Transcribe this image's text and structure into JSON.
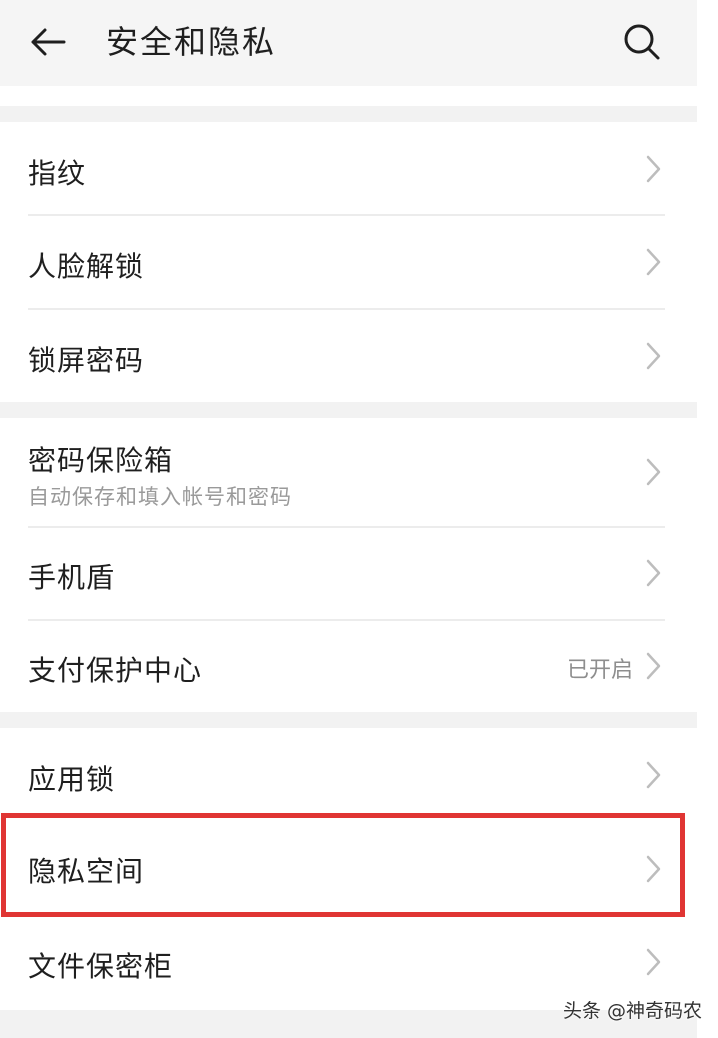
{
  "header": {
    "title": "安全和隐私",
    "back_icon": "arrow-left-icon",
    "search_icon": "search-icon"
  },
  "groups": [
    {
      "items": [
        {
          "label": "指纹"
        },
        {
          "label": "人脸解锁"
        },
        {
          "label": "锁屏密码"
        }
      ]
    },
    {
      "items": [
        {
          "label": "密码保险箱",
          "subtitle": "自动保存和填入帐号和密码"
        },
        {
          "label": "手机盾"
        },
        {
          "label": "支付保护中心",
          "value": "已开启"
        }
      ]
    },
    {
      "items": [
        {
          "label": "应用锁"
        },
        {
          "label": "隐私空间",
          "highlighted": true
        },
        {
          "label": "文件保密柜"
        }
      ]
    }
  ],
  "colors": {
    "highlight": "#e03533",
    "header_bg": "#f5f5f5",
    "group_gap": "#f2f2f2"
  },
  "watermark": "头条 @神奇码农"
}
